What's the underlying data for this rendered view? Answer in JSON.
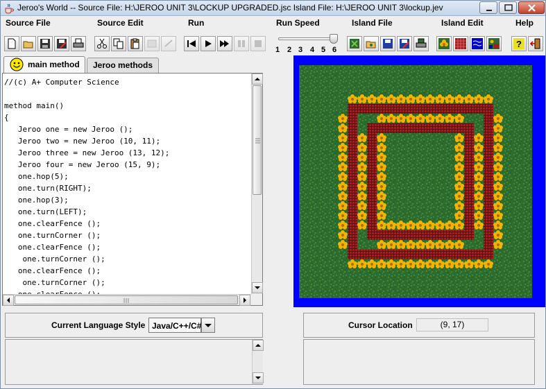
{
  "window": {
    "title": "Jeroo's World -- Source File: H:\\JEROO UNIT 3\\LOCKUP UPGRADED.jsc     Island File: H:\\JEROO UNIT 3\\lockup.jev"
  },
  "menu": [
    "Source File",
    "Source Edit",
    "Run",
    "Run Speed",
    "Island File",
    "Island Edit",
    "Help"
  ],
  "toolbar": {
    "speed_ticks": [
      "1",
      "2",
      "3",
      "4",
      "5",
      "6"
    ],
    "speed_value": 6,
    "icons": [
      "new-file-icon",
      "open-file-icon",
      "save-icon",
      "save-as-icon",
      "print-icon",
      "cut-icon",
      "copy-icon",
      "paste-icon",
      "undo-icon",
      "redo-icon",
      "reset-icon",
      "step-icon",
      "run-icon",
      "pause-icon",
      "stop-icon",
      "new-island-icon",
      "open-island-icon",
      "save-island-icon",
      "save-island-as-icon",
      "print-island-icon",
      "flower-icon",
      "net-icon",
      "water-icon",
      "clear-island-icon",
      "help-icon",
      "exit-icon"
    ]
  },
  "tabs": {
    "main": "main method",
    "jeroo": "Jeroo methods"
  },
  "code_lines": [
    "//(c) A+ Computer Science",
    "",
    "method main()",
    "{",
    "   Jeroo one = new Jeroo ();",
    "   Jeroo two = new Jeroo (10, 11);",
    "   Jeroo three = new Jeroo (13, 12);",
    "   Jeroo four = new Jeroo (15, 9);",
    "   one.hop(5);",
    "   one.turn(RIGHT);",
    "   one.hop(3);",
    "   one.turn(LEFT);",
    "   one.clearFence ();",
    "   one.turnCorner ();",
    "   one.clearFence ();",
    "    one.turnCorner ();",
    "   one.clearFence ();",
    "    one.turnCorner ();",
    "   one.clearFence ();"
  ],
  "language": {
    "label": "Current Language Style",
    "value": "Java/C++/C#"
  },
  "cursor": {
    "label": "Cursor Location",
    "value": "(9, 17)"
  },
  "island": {
    "grass_color": "#2e6b2e",
    "water_color": "#0000ff",
    "net_color": "#a31f1f",
    "flower_color": "#f2b400"
  }
}
